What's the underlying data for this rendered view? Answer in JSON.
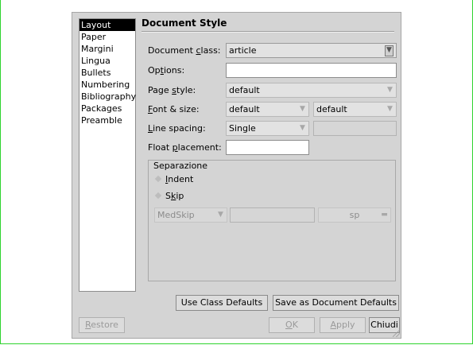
{
  "sidebar": {
    "items": [
      {
        "label": "Layout"
      },
      {
        "label": "Paper"
      },
      {
        "label": "Margini"
      },
      {
        "label": "Lingua"
      },
      {
        "label": "Bullets"
      },
      {
        "label": "Numbering"
      },
      {
        "label": "Bibliography"
      },
      {
        "label": "Packages"
      },
      {
        "label": "Preamble"
      }
    ],
    "selected": "Layout"
  },
  "section_title": "Document Style",
  "document_class": {
    "label_pre": "Document ",
    "label_u": "c",
    "label_post": "lass:",
    "value": "article"
  },
  "options": {
    "label_pre": "Op",
    "label_u": "t",
    "label_post": "ions:",
    "value": ""
  },
  "page_style": {
    "label_pre": "Page ",
    "label_u": "s",
    "label_post": "tyle:",
    "value": "default"
  },
  "font_size": {
    "label_u": "F",
    "label_post": "ont & size:",
    "font_value": "default",
    "size_value": "default"
  },
  "line_spacing": {
    "label_u": "L",
    "label_post": "ine spacing:",
    "value": "Single",
    "custom_value": ""
  },
  "float_placement": {
    "label_pre": "Float ",
    "label_u": "p",
    "label_post": "lacement:",
    "value": ""
  },
  "separation": {
    "legend": "Separazione",
    "indent": {
      "label_u": "I",
      "label_post": "ndent"
    },
    "skip": {
      "label_pre": "S",
      "label_u": "k",
      "label_post": "ip"
    },
    "skip_value": "MedSkip",
    "skip_length": "",
    "skip_unit": "sp"
  },
  "buttons": {
    "use_class_defaults": "Use Class Defaults",
    "save_defaults": "Save as Document Defaults",
    "restore_u": "R",
    "restore_post": "estore",
    "ok_u": "O",
    "ok_post": "K",
    "apply_u": "A",
    "apply_post": "pply",
    "close": "Chiudi"
  },
  "icons": {
    "combo_arrow": "combo-arrow-icon",
    "radio": "radio-diamond-icon"
  }
}
